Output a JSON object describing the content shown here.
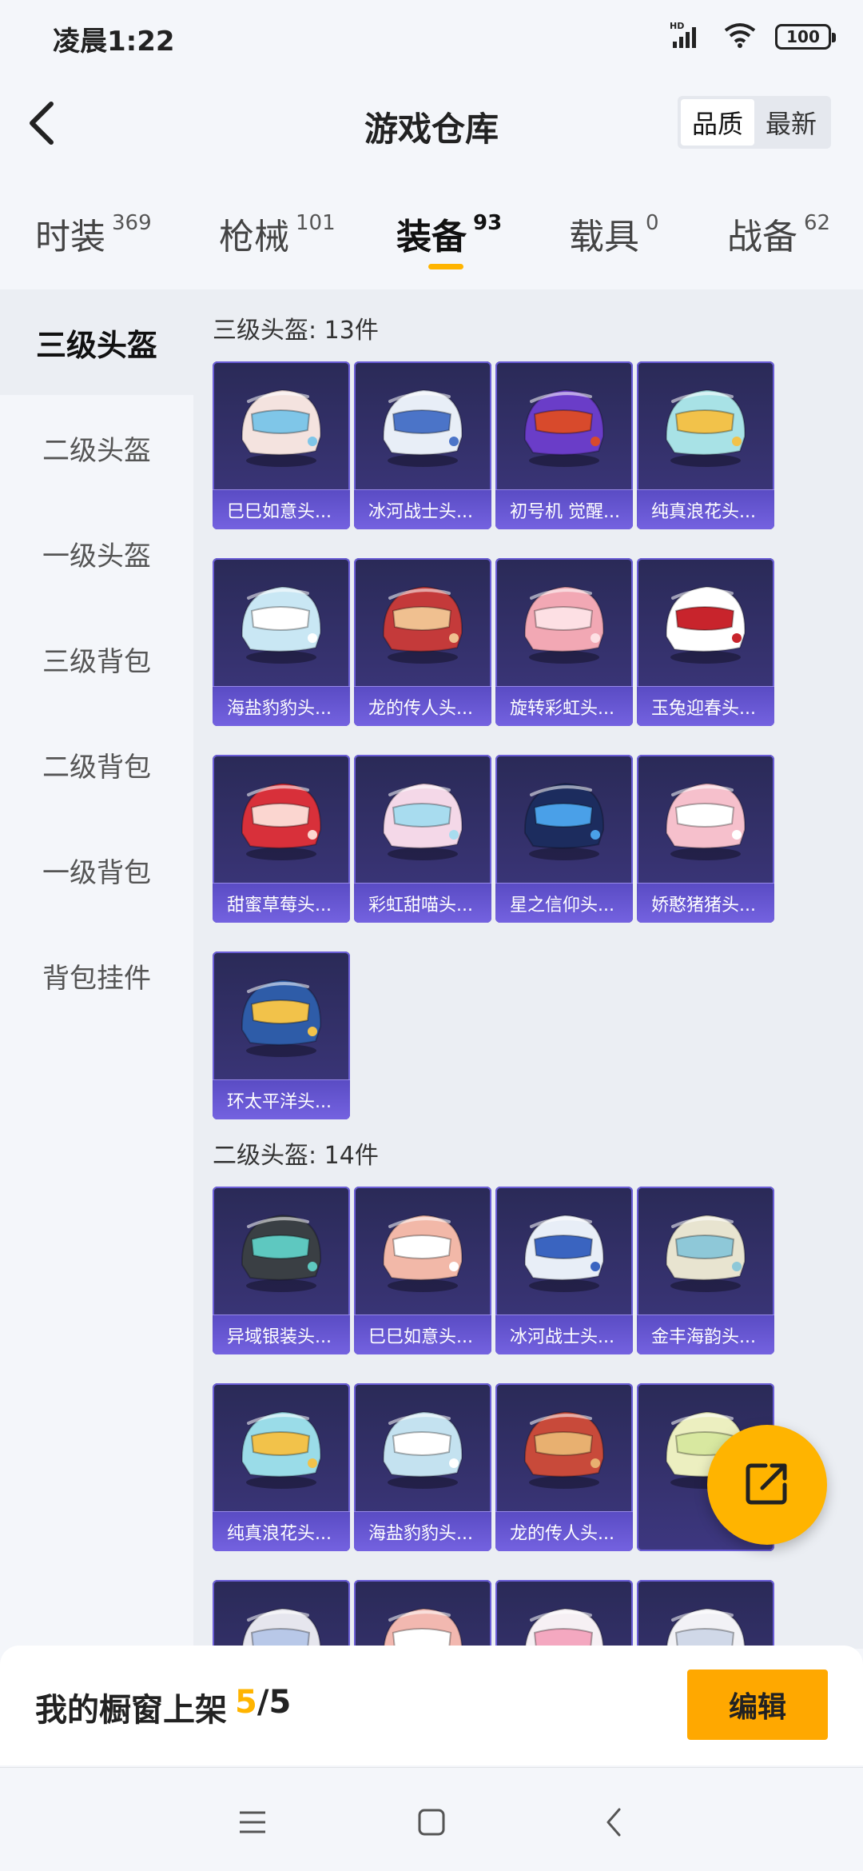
{
  "status": {
    "time": "凌晨1:22",
    "battery": "100",
    "signal_label": "HD"
  },
  "header": {
    "title": "游戏仓库",
    "sort_options": [
      "品质",
      "最新"
    ],
    "active_sort": "品质"
  },
  "tabs": [
    {
      "label": "时装",
      "count": "369"
    },
    {
      "label": "枪械",
      "count": "101"
    },
    {
      "label": "装备",
      "count": "93"
    },
    {
      "label": "载具",
      "count": "0"
    },
    {
      "label": "战备",
      "count": "62"
    }
  ],
  "active_tab": "装备",
  "sidebar": {
    "items": [
      "三级头盔",
      "二级头盔",
      "一级头盔",
      "三级背包",
      "二级背包",
      "一级背包",
      "背包挂件"
    ],
    "active": "三级头盔"
  },
  "sections": [
    {
      "title": "三级头盔: 13件",
      "items": [
        {
          "name": "巳巳如意头...",
          "color": "#f4e3df",
          "accent": "#7fc6e8"
        },
        {
          "name": "冰河战士头...",
          "color": "#e8eef7",
          "accent": "#4b74c8"
        },
        {
          "name": "初号机 觉醒...",
          "color": "#6a3dc8",
          "accent": "#d84a2c"
        },
        {
          "name": "纯真浪花头...",
          "color": "#a8e2e6",
          "accent": "#f2c24a"
        },
        {
          "name": "海盐豹豹头...",
          "color": "#c9e7f4",
          "accent": "#ffffff"
        },
        {
          "name": "龙的传人头...",
          "color": "#c43a3a",
          "accent": "#f0c090"
        },
        {
          "name": "旋转彩虹头...",
          "color": "#f2a8b4",
          "accent": "#fde0e4"
        },
        {
          "name": "玉兔迎春头...",
          "color": "#ffffff",
          "accent": "#c8242c"
        },
        {
          "name": "甜蜜草莓头...",
          "color": "#d8303a",
          "accent": "#fbd6d0"
        },
        {
          "name": "彩虹甜喵头...",
          "color": "#f4d8e8",
          "accent": "#a8dcef"
        },
        {
          "name": "星之信仰头...",
          "color": "#1c2c5e",
          "accent": "#4aa0e8"
        },
        {
          "name": "娇憨猪猪头...",
          "color": "#f6c0cc",
          "accent": "#ffffff"
        },
        {
          "name": "环太平洋头...",
          "color": "#2e5ca8",
          "accent": "#f2c24a"
        }
      ]
    },
    {
      "title": "二级头盔: 14件",
      "items": [
        {
          "name": "异域银装头...",
          "color": "#3a3f44",
          "accent": "#5ec8c0"
        },
        {
          "name": "巳巳如意头...",
          "color": "#f2b8a8",
          "accent": "#ffffff"
        },
        {
          "name": "冰河战士头...",
          "color": "#e8eef7",
          "accent": "#3a64c0"
        },
        {
          "name": "金丰海韵头...",
          "color": "#e8e4d0",
          "accent": "#8ec8d8"
        },
        {
          "name": "纯真浪花头...",
          "color": "#9adce8",
          "accent": "#f2c24a"
        },
        {
          "name": "海盐豹豹头...",
          "color": "#c4e2f0",
          "accent": "#ffffff"
        },
        {
          "name": "龙的传人头...",
          "color": "#c84a3a",
          "accent": "#e8b070"
        },
        {
          "name": "",
          "color": "#ecefc0",
          "accent": "#d8e8a0"
        },
        {
          "name": "",
          "color": "#e6e6ee",
          "accent": "#b8c8e8"
        },
        {
          "name": "",
          "color": "#f2b8b0",
          "accent": "#ffffff"
        },
        {
          "name": "",
          "color": "#f6f0f4",
          "accent": "#f4a8c0"
        },
        {
          "name": "",
          "color": "#f2f2f6",
          "accent": "#d0d8e8"
        }
      ]
    }
  ],
  "shelf": {
    "label": "我的橱窗上架",
    "current": "5",
    "total": "/5"
  },
  "edit_label": "编辑",
  "colors": {
    "accent": "#ffb400",
    "card_bg": "#2e2c62",
    "card_label": "#6a58d8"
  }
}
